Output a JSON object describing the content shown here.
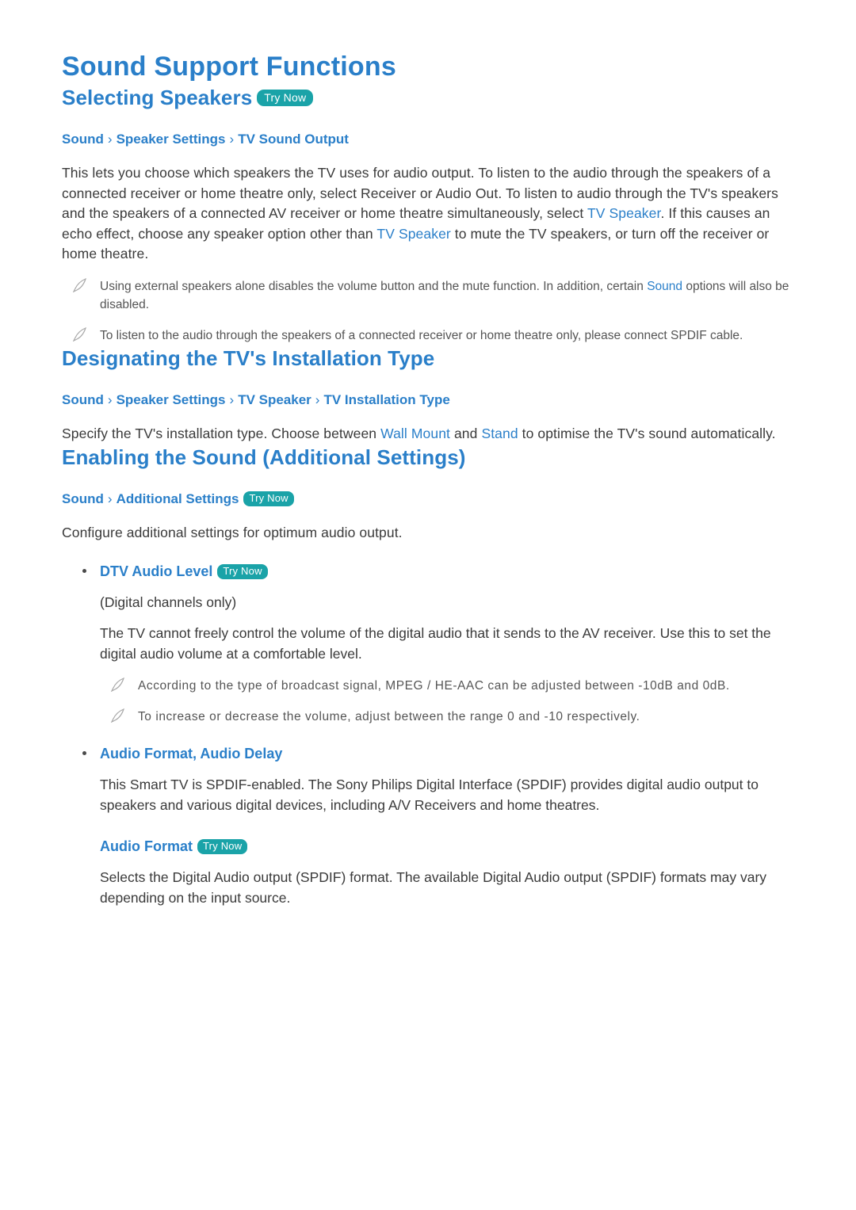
{
  "doc": {
    "title": "Sound Support Functions"
  },
  "try_now_label": "Try Now",
  "sections": [
    {
      "title": "Selecting Speakers",
      "has_try_now": true,
      "breadcrumb": [
        "Sound",
        "Speaker Settings",
        "TV Sound Output"
      ],
      "body_parts": [
        {
          "text": "This lets you choose which speakers the TV uses for audio output. To listen to the audio through the speakers of a connected receiver or home theatre only, select Receiver or Audio Out. To listen to audio through the TV's speakers and the speakers of a connected AV receiver or home theatre simultaneously, select "
        },
        {
          "text": "TV Speaker",
          "highlight": true
        },
        {
          "text": ". If this causes an echo effect, choose any speaker option other than "
        },
        {
          "text": "TV Speaker",
          "highlight": true
        },
        {
          "text": " to mute the TV speakers, or turn off the receiver or home theatre."
        }
      ],
      "notes": [
        {
          "parts": [
            {
              "text": "Using external speakers alone disables the volume button and the mute function. In addition, certain "
            },
            {
              "text": "Sound",
              "highlight": true
            },
            {
              "text": " options will also be disabled."
            }
          ]
        },
        {
          "parts": [
            {
              "text": "To listen to the audio through the speakers of a connected receiver or home theatre only, please connect SPDIF cable."
            }
          ]
        }
      ]
    },
    {
      "title": "Designating the TV's Installation Type",
      "has_try_now": false,
      "breadcrumb": [
        "Sound",
        "Speaker Settings",
        "TV Speaker",
        "TV Installation Type"
      ],
      "body_parts": [
        {
          "text": "Specify the TV's installation type. Choose between "
        },
        {
          "text": "Wall Mount",
          "highlight": true
        },
        {
          "text": " and "
        },
        {
          "text": "Stand",
          "highlight": true
        },
        {
          "text": " to optimise the TV's sound automatically."
        }
      ]
    },
    {
      "title": "Enabling the Sound (Additional Settings)",
      "has_try_now": false,
      "breadcrumb": [
        "Sound",
        "Additional Settings"
      ],
      "breadcrumb_try_now": true,
      "body_parts": [
        {
          "text": "Configure additional settings for optimum audio output."
        }
      ]
    }
  ],
  "items": [
    {
      "label": "DTV Audio Level",
      "has_try_now": true,
      "sub_texts": [
        "(Digital channels only)",
        "The TV cannot freely control the volume of the digital audio that it sends to the AV receiver. Use this to set the digital audio volume at a comfortable level."
      ],
      "notes": [
        "According to the type of broadcast signal, MPEG / HE-AAC can be adjusted between -10dB and 0dB.",
        "To increase or decrease the volume, adjust between the range 0 and -10 respectively."
      ]
    },
    {
      "label": "Audio Format, Audio Delay",
      "has_try_now": false,
      "sub_texts": [
        "This Smart TV is SPDIF-enabled. The Sony Philips Digital Interface (SPDIF) provides digital audio output to speakers and various digital devices, including A/V Receivers and home theatres."
      ],
      "sub_head": "Audio Format",
      "sub_head_try_now": true,
      "sub_head_texts": [
        "Selects the Digital Audio output (SPDIF) format. The available Digital Audio output (SPDIF) formats may vary depending on the input source."
      ]
    }
  ]
}
